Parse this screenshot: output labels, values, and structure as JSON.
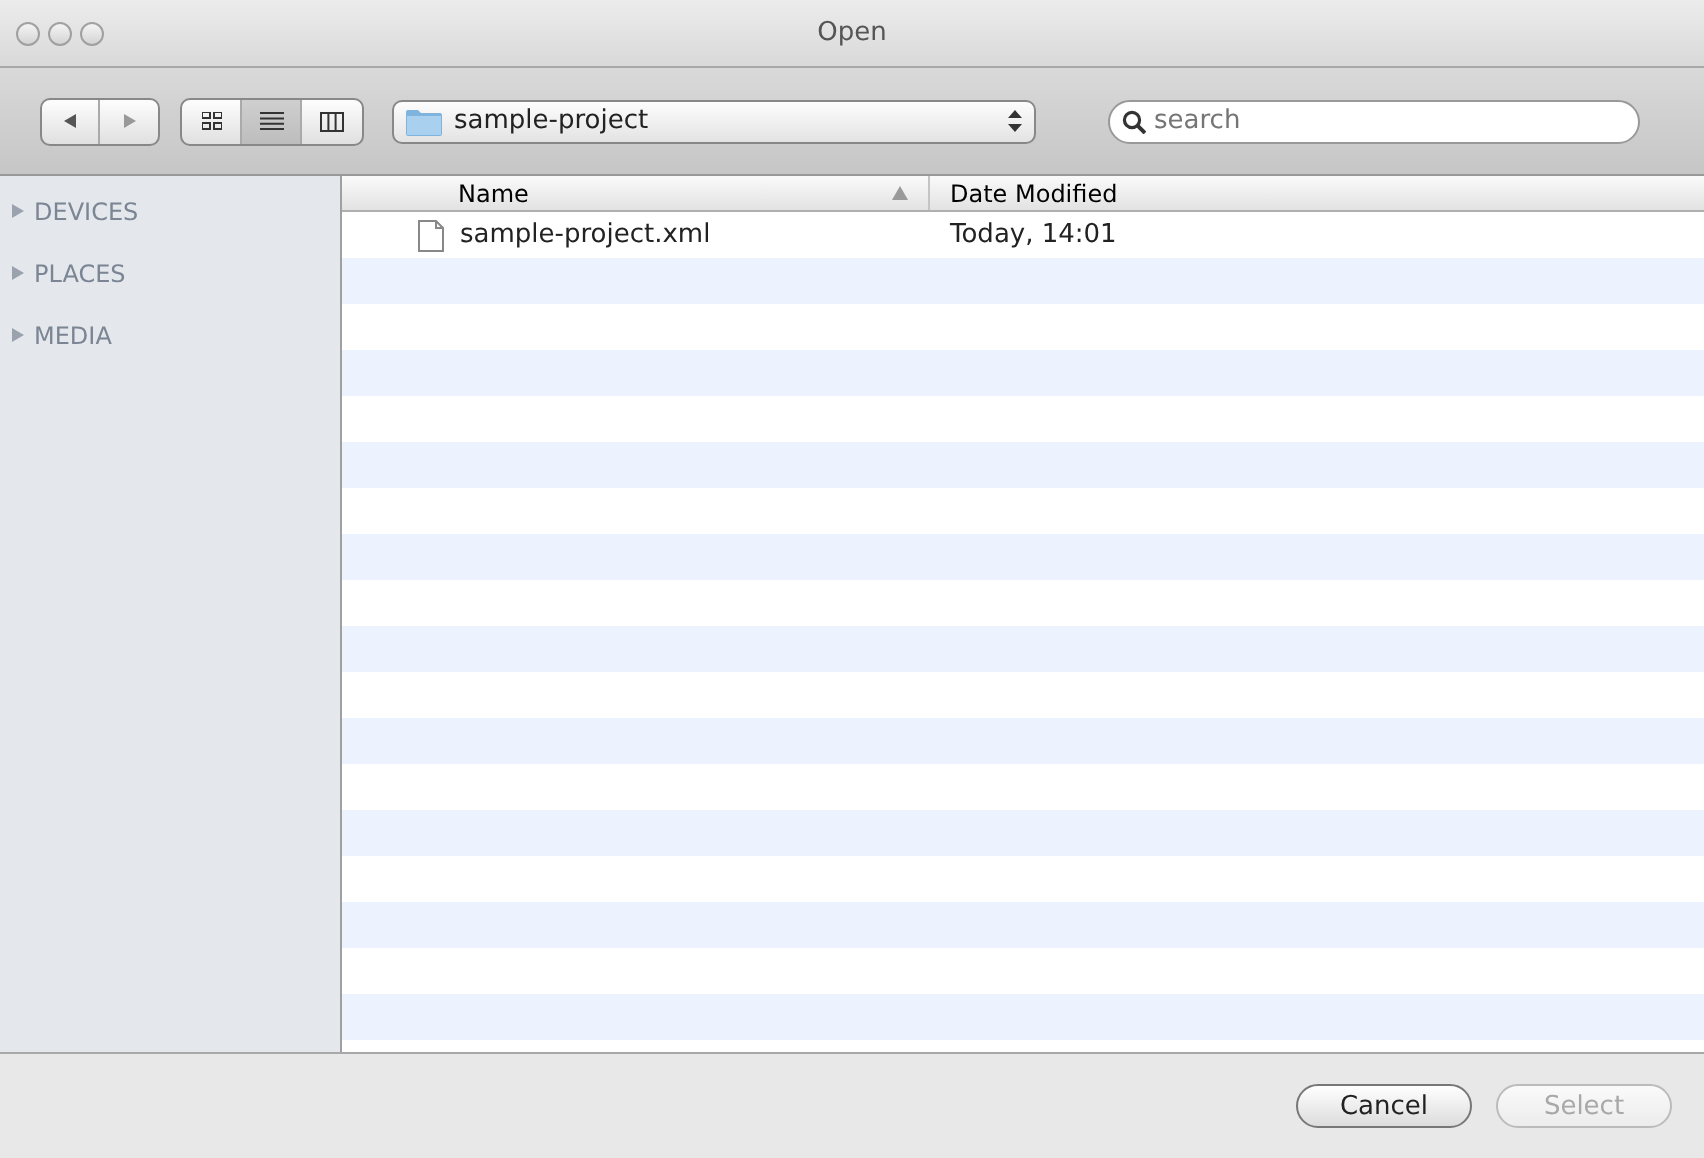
{
  "window": {
    "title": "Open"
  },
  "toolbar": {
    "view_modes": [
      {
        "kind": "icons",
        "selected": false
      },
      {
        "kind": "list",
        "selected": true
      },
      {
        "kind": "columns",
        "selected": false
      }
    ],
    "location": "sample-project",
    "search": {
      "placeholder": "search"
    }
  },
  "sidebar": {
    "sections": [
      {
        "label": "DEVICES",
        "expanded": false
      },
      {
        "label": "PLACES",
        "expanded": false
      },
      {
        "label": "MEDIA",
        "expanded": false
      }
    ]
  },
  "table": {
    "columns": [
      {
        "label": "Name",
        "sorted": true
      },
      {
        "label": "Date Modified",
        "sorted": false
      }
    ],
    "rows": [
      {
        "name": "sample-project.xml",
        "date": "Today, 14:01",
        "selected": false
      }
    ]
  },
  "buttons": [
    {
      "label": "Cancel",
      "disabled": false
    },
    {
      "label": "Select",
      "disabled": true
    }
  ]
}
